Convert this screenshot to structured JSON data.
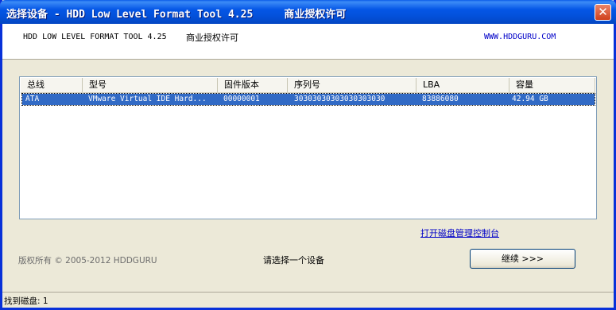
{
  "window": {
    "title": "选择设备 - HDD Low Level Format Tool 4.25     商业授权许可"
  },
  "header": {
    "product": "HDD LOW LEVEL FORMAT TOOL 4.25",
    "license": "商业授权许可",
    "url": "WWW.HDDGURU.COM"
  },
  "device_list": {
    "columns": [
      "总线",
      "型号",
      "固件版本",
      "序列号",
      "LBA",
      "容量"
    ],
    "rows": [
      [
        "ATA",
        "VMware Virtual IDE Hard...",
        "00000001",
        "30303030303030303030",
        "83886080",
        "42.94 GB"
      ]
    ]
  },
  "link": {
    "disk_mgmt": "打开磁盘管理控制台"
  },
  "footer": {
    "copyright": "版权所有 © 2005-2012 HDDGURU",
    "prompt": "请选择一个设备",
    "continue_label": "继续 >>>"
  },
  "status": {
    "text": "找到磁盘: 1"
  },
  "icons": {
    "close": "close-icon"
  }
}
